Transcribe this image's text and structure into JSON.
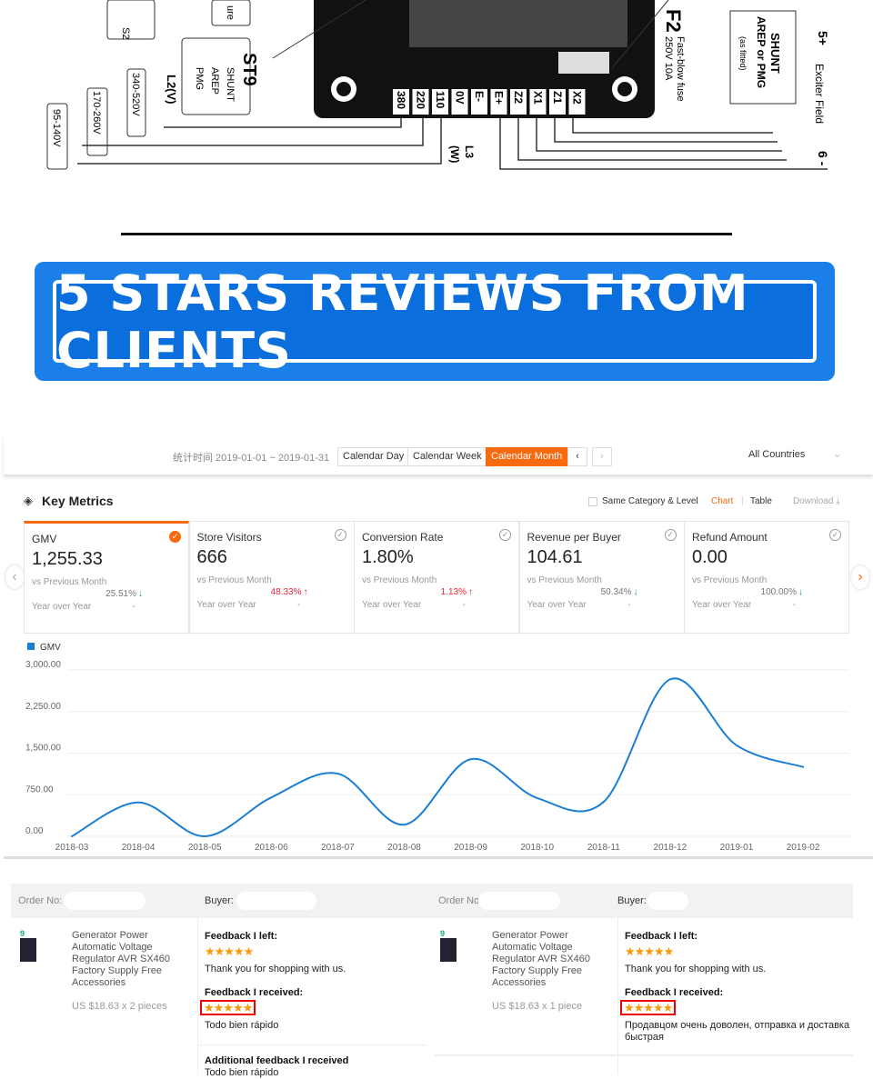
{
  "diagram": {
    "labels": [
      "S2",
      "ure",
      "ST9",
      "SHUNT",
      "AREP",
      "PMG",
      "L2(V)",
      "340-520V",
      "170-260V",
      "95-140V",
      "F2",
      "Fast-blow fuse",
      "250V 10A",
      "SHUNT",
      "AREP or PMG",
      "(as fitted)",
      "5+",
      "Exciter Field",
      "6 -",
      "L3",
      "(W)"
    ],
    "terminals": [
      "380",
      "220",
      "110",
      "0V",
      "E-",
      "E+",
      "Z2",
      "X1",
      "Z1",
      "X2"
    ]
  },
  "banner": {
    "text": "5 STARS REVIEWS FROM CLIENTS",
    "color": "#1a7fe8"
  },
  "topbar": {
    "date_range": "统计时间 2019-01-01 ~ 2019-01-31",
    "buttons": [
      "Calendar Day",
      "Calendar Week",
      "Calendar Month"
    ],
    "active": "Calendar Month",
    "prev": "‹",
    "next": "›",
    "country": "All Countries",
    "accent": "#f86a0f"
  },
  "metrics": {
    "title": "Key Metrics",
    "same_category": "Same Category & Level",
    "chart": "Chart",
    "sep": "|",
    "table": "Table",
    "download": "Download ⤓",
    "cards": [
      {
        "label": "GMV",
        "value": "1,255.33",
        "vs": "vs Previous Month",
        "pct": "25.51%",
        "dir": "down",
        "yoy": "Year over Year",
        "yoy_val": "-",
        "selected": true
      },
      {
        "label": "Store Visitors",
        "value": "666",
        "vs": "vs Previous Month",
        "pct": "48.33%",
        "dir": "up",
        "yoy": "Year over Year",
        "yoy_val": "-",
        "selected": false
      },
      {
        "label": "Conversion Rate",
        "value": "1.80%",
        "vs": "vs Previous Month",
        "pct": "1.13%",
        "dir": "up",
        "yoy": "Year over Year",
        "yoy_val": "-",
        "selected": false
      },
      {
        "label": "Revenue per Buyer",
        "value": "104.61",
        "vs": "vs Previous Month",
        "pct": "50.34%",
        "dir": "down",
        "yoy": "Year over Year",
        "yoy_val": "-",
        "selected": false
      },
      {
        "label": "Refund Amount",
        "value": "0.00",
        "vs": "vs Previous Month",
        "pct": "100.00%",
        "dir": "down",
        "yoy": "Year over Year",
        "yoy_val": "-",
        "selected": false
      }
    ]
  },
  "chart_data": {
    "type": "line",
    "legend": "GMV",
    "legend_position": "top-left",
    "color": "#1a7fd4",
    "grid": true,
    "yticks": [
      "3,000.00",
      "2,250.00",
      "1,500.00",
      "750.00",
      "0.00"
    ],
    "ylim": [
      0,
      3000
    ],
    "categories": [
      "2018-03",
      "2018-04",
      "2018-05",
      "2018-06",
      "2018-07",
      "2018-08",
      "2018-09",
      "2018-10",
      "2018-11",
      "2018-12",
      "2019-01",
      "2019-02"
    ],
    "series": [
      {
        "name": "GMV",
        "values": [
          0,
          610,
          0,
          700,
          1130,
          210,
          1390,
          690,
          620,
          2830,
          1640,
          1250
        ]
      }
    ]
  },
  "orders": [
    {
      "order_label": "Order No:",
      "buyer_label": "Buyer:",
      "product": [
        "Generator Power",
        "Automatic Voltage",
        "Regulator AVR SX460",
        "Factory Supply Free",
        "Accessories"
      ],
      "price": "US $18.63 x 2 pieces",
      "left_title": "Feedback I left:",
      "left_stars": "★★★★★",
      "left_text": "Thank you for shopping with us.",
      "recv_title": "Feedback I received:",
      "recv_stars": "★★★★★",
      "recv_text": "Todo bien rápido",
      "add_title": "Additional feedback I received",
      "add_text": "Todo bien rápido"
    },
    {
      "order_label": "Order No:",
      "buyer_label": "Buyer:",
      "product": [
        "Generator Power",
        "Automatic Voltage",
        "Regulator AVR SX460",
        "Factory Supply Free",
        "Accessories"
      ],
      "price": "US $18.63 x 1 piece",
      "left_title": "Feedback I left:",
      "left_stars": "★★★★★",
      "left_text": "Thank you for shopping with us.",
      "recv_title": "Feedback I received:",
      "recv_stars": "★★★★★",
      "recv_text": "Продавцом очень доволен, отправка и доставка быстрая"
    }
  ]
}
